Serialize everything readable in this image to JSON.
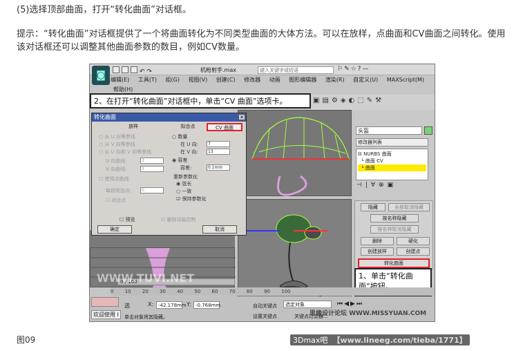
{
  "step_text": "(5)选择顶部曲面，打开“转化曲面”对话框。",
  "tip_text": "提示：“转化曲面”对话框提供了一个将曲面转化为不同类型曲面的大体方法。可以在放样，点曲面和CV曲面之间转化。使用该对话框还可以调整其他曲面参数的数目，例如CV数量。",
  "figure_label": "图09",
  "footer_watermark": {
    "left": "3Dmax吧",
    "right": "【www.lineeg.com/tieba/1771】"
  },
  "app": {
    "title": "机枪射手.max",
    "search_placeholder": "键入关键字或短语",
    "menus": [
      "编辑(E)",
      "工具(T)",
      "组(G)",
      "视图(V)",
      "创建(C)",
      "修改器",
      "动画",
      "图形编辑器",
      "渲染(R)",
      "自定义(U)",
      "MAXScript(M)"
    ],
    "help_menu": "帮助(H)"
  },
  "callouts": {
    "top": "2、在打开“转化曲面”对话框中，单击“CV 曲面”选项卡。",
    "bottom": "1、单击“转化曲面”按钮。"
  },
  "command_panel": {
    "object_name": "头盔",
    "modifier_list": "修改器列表",
    "stack": [
      "NURBS 曲面",
      "曲面 CV",
      "曲面"
    ],
    "buttons": {
      "hide": "隐藏",
      "unhide_all": "全部取消隐藏",
      "hide_by_name": "按名称隐藏",
      "unhide_by_name": "按名称取消隐藏",
      "delete": "删除",
      "make_rigid": "硬化",
      "create_loft": "创建放样",
      "create_point": "创建点",
      "convert_surface": "转化曲面"
    }
  },
  "dialog": {
    "title": "转化曲面",
    "tabs": [
      "放样",
      "拟合点",
      "CV 曲面"
    ],
    "loft_options": [
      "从 U 向等参线",
      "从 V 向等参线",
      "从 U 向和 V 向等参线"
    ],
    "u_curves_label": "U 向曲线:",
    "v_curves_label": "V 向曲线:",
    "u_curves_value": "3",
    "v_curves_value": "3",
    "use_point_curves": "使用点曲线",
    "extra_points_label": "每段附加点:",
    "extra_points_value": "0",
    "capped": "闭合点",
    "count_label": "数量",
    "in_u_label": "在 U 向:",
    "in_v_label": "在 V 向:",
    "in_u_value": "7",
    "in_v_value": "13",
    "tolerance_label": "容差",
    "tolerance_field_label": "容差:",
    "tolerance_value": "0.1mm",
    "reparam_label": "重新参数化",
    "chord_length": "弦长",
    "uniform": "一致",
    "keep_params": "保持参数化",
    "preview": "预览",
    "remove_animation": "删除动画控制",
    "ok": "确定",
    "cancel": "取消"
  },
  "bottom": {
    "time_slider": "0 / 100",
    "ruler_ticks": [
      "0",
      "10",
      "20",
      "30",
      "40",
      "50",
      "60",
      "70",
      "80",
      "90",
      "100"
    ],
    "welcome": "欢迎使用 I",
    "selection_label": "选",
    "x_label": "X:",
    "x_value": "-42.178mm",
    "y_label": "Y:",
    "y_value": "-0.768mm",
    "auto_key": "自动关键点",
    "set_key": "设置关键点",
    "selected_object": "选定对象",
    "key_filters": "关键点过滤器...",
    "hint": "单击对象将其隐藏。"
  },
  "image_watermarks": [
    "思缘设计论坛 WWW.MISSYUAN.COM",
    "WWW.TUVI.NET"
  ],
  "colors": {
    "highlight": "#e0202a",
    "stack_selected": "#ffea00",
    "title_blue": "#3a5aa8"
  }
}
